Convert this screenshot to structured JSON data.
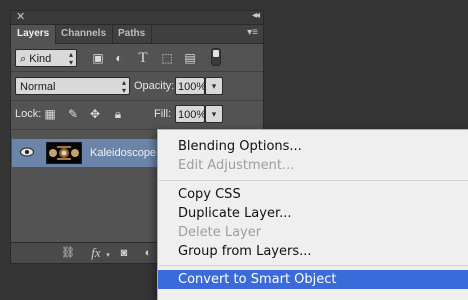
{
  "panel": {
    "tabs": [
      "Layers",
      "Channels",
      "Paths"
    ],
    "filter": {
      "kind_label": "Kind"
    },
    "blend_mode": "Normal",
    "opacity": {
      "label": "Opacity:",
      "value": "100%"
    },
    "lock": {
      "label": "Lock:"
    },
    "fill": {
      "label": "Fill:",
      "value": "100%"
    },
    "layer": {
      "name": "Kaleidoscope"
    }
  },
  "context_menu": {
    "items": [
      "Blending Options...",
      "Edit Adjustment...",
      "Copy CSS",
      "Duplicate Layer...",
      "Delete Layer",
      "Group from Layers...",
      "Convert to Smart Object"
    ],
    "selected": "Convert to Smart Object",
    "disabled": [
      "Edit Adjustment...",
      "Delete Layer"
    ]
  },
  "colors": {
    "panel_bg": "#535353",
    "selected_layer": "#6a85a8",
    "menu_highlight": "#3b6bd9"
  }
}
